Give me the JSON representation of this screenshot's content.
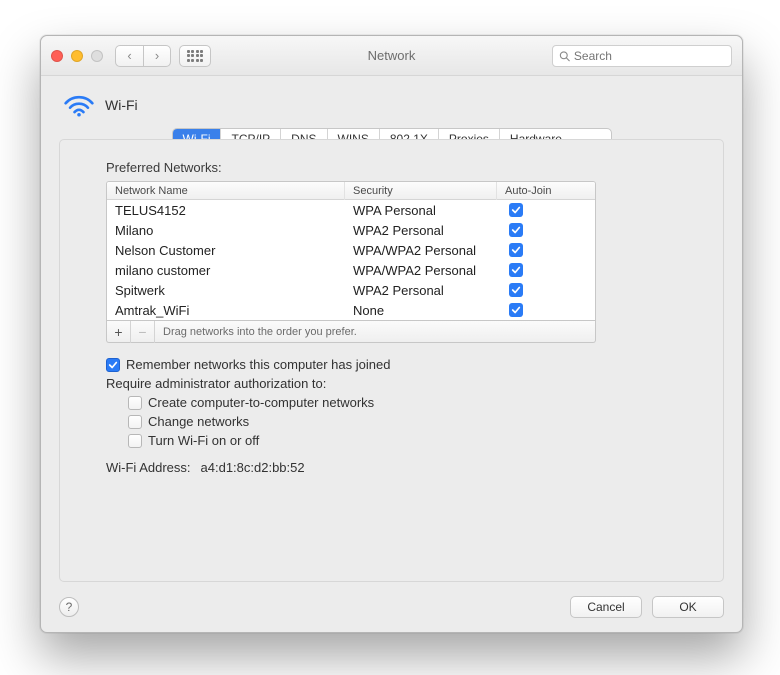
{
  "window": {
    "title": "Network"
  },
  "search": {
    "placeholder": "Search"
  },
  "header": {
    "title": "Wi-Fi"
  },
  "tabs": [
    {
      "label": "Wi-Fi",
      "active": true
    },
    {
      "label": "TCP/IP",
      "active": false
    },
    {
      "label": "DNS",
      "active": false
    },
    {
      "label": "WINS",
      "active": false
    },
    {
      "label": "802.1X",
      "active": false
    },
    {
      "label": "Proxies",
      "active": false
    },
    {
      "label": "Hardware",
      "active": false
    }
  ],
  "preferred_label": "Preferred Networks:",
  "columns": {
    "name": "Network Name",
    "security": "Security",
    "auto": "Auto-Join"
  },
  "networks": [
    {
      "name": "TELUS4152",
      "security": "WPA Personal",
      "auto": true
    },
    {
      "name": "Milano",
      "security": "WPA2 Personal",
      "auto": true
    },
    {
      "name": "Nelson Customer",
      "security": "WPA/WPA2 Personal",
      "auto": true
    },
    {
      "name": "milano customer",
      "security": "WPA/WPA2 Personal",
      "auto": true
    },
    {
      "name": "Spitwerk",
      "security": "WPA2 Personal",
      "auto": true
    },
    {
      "name": "Amtrak_WiFi",
      "security": "None",
      "auto": true
    }
  ],
  "drag_hint": "Drag networks into the order you prefer.",
  "remember": {
    "label": "Remember networks this computer has joined",
    "checked": true
  },
  "require_label": "Require administrator authorization to:",
  "require_opts": [
    {
      "label": "Create computer-to-computer networks",
      "checked": false
    },
    {
      "label": "Change networks",
      "checked": false
    },
    {
      "label": "Turn Wi-Fi on or off",
      "checked": false
    }
  ],
  "wifi_address": {
    "label": "Wi-Fi Address:",
    "value": "a4:d1:8c:d2:bb:52"
  },
  "buttons": {
    "cancel": "Cancel",
    "ok": "OK"
  }
}
